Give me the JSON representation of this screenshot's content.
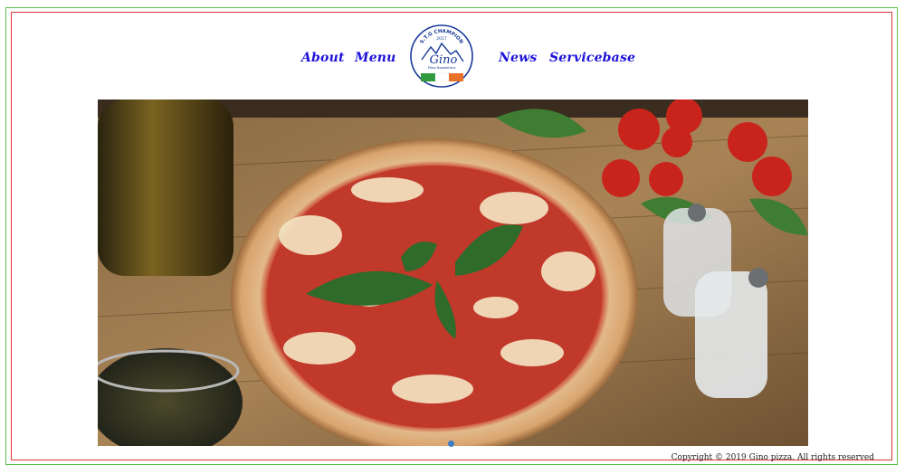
{
  "nav": {
    "items": [
      {
        "label": "About"
      },
      {
        "label": "Menu"
      },
      {
        "label": "News"
      },
      {
        "label": "Servicebase"
      }
    ]
  },
  "logo": {
    "top_text": "S.T.G CHAMPION",
    "year": "2017",
    "brand": "Gino",
    "subtitle": "Pizza Napoletana"
  },
  "hero": {
    "icon": "pizza-photo",
    "slides": 1
  },
  "footer": {
    "copyright": "Copyright © 2019 Gino pizza. All rights reserved"
  },
  "colors": {
    "nav_link": "#1d12d8",
    "frame_outer": "#5cbf45",
    "frame_inner": "#e0343c",
    "dot_active": "#3a7ec6"
  }
}
